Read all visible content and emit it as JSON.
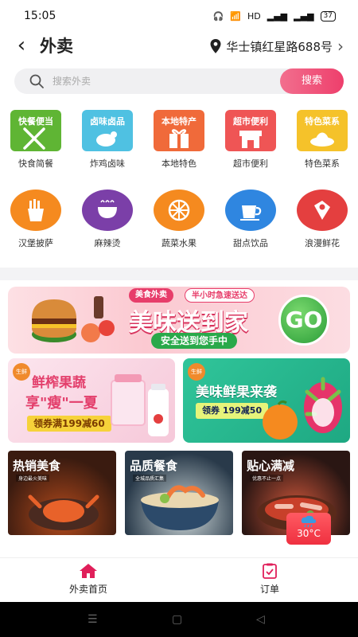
{
  "status": {
    "time": "15:05",
    "indicators": "HD",
    "battery": "37"
  },
  "header": {
    "back_icon": "chevron-left-icon",
    "title": "外卖",
    "location": "华士镇红星路688号"
  },
  "search": {
    "placeholder": "搜索外卖",
    "button": "搜索"
  },
  "categories_row1": [
    {
      "tag": "快餐便当",
      "label": "快食简餐",
      "color": "#5fb534"
    },
    {
      "tag": "卤味卤品",
      "label": "炸鸡卤味",
      "color": "#4fc1e2"
    },
    {
      "tag": "本地特产",
      "label": "本地特色",
      "color": "#f06a3a"
    },
    {
      "tag": "超市便利",
      "label": "超市便利",
      "color": "#ef5555"
    },
    {
      "tag": "特色菜系",
      "label": "特色菜系",
      "color": "#f5c22a"
    }
  ],
  "categories_row2": [
    {
      "label": "汉堡披萨",
      "color": "#f58a1f"
    },
    {
      "label": "麻辣烫",
      "color": "#7b3fa8"
    },
    {
      "label": "蔬菜水果",
      "color": "#f58a1f"
    },
    {
      "label": "甜点饮品",
      "color": "#2f86e0"
    },
    {
      "label": "浪漫鲜花",
      "color": "#e43f3f"
    }
  ],
  "banner": {
    "pill1": "美食外卖",
    "pill2": "半小时急速送达",
    "headline": "美味送到家",
    "sub": "安全送到您手中",
    "go": "GO"
  },
  "promos": {
    "left": {
      "badge": "生鲜",
      "line1": "鲜榨果蔬",
      "line2": "享\"瘦\"一夏",
      "coupon": "领券满199减60"
    },
    "right": {
      "badge": "生鲜",
      "line1": "美味鲜果来袭",
      "coupon": "领券 199减50"
    }
  },
  "food_cards": [
    {
      "title": "热销美食",
      "sub": "身边最火美味"
    },
    {
      "title": "品质餐食",
      "sub": "全城品质汇集"
    },
    {
      "title": "贴心满减",
      "sub": "优惠不止一点"
    }
  ],
  "weather": {
    "temp": "30°C"
  },
  "nav": {
    "home": "外卖首页",
    "orders": "订单"
  }
}
